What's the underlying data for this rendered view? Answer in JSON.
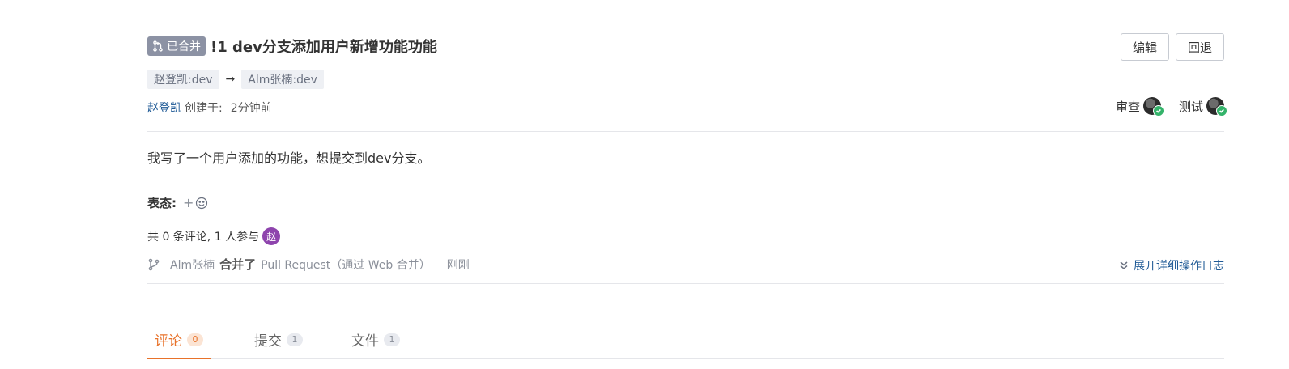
{
  "header": {
    "status_badge": "已合并",
    "title": "!1 dev分支添加用户新增功能功能",
    "actions": {
      "edit": "编辑",
      "revert": "回退"
    }
  },
  "branches": {
    "source": "赵登凯:dev",
    "arrow": "→",
    "target": "Alm张楠:dev"
  },
  "meta": {
    "author": "赵登凯",
    "created_label": "创建于:",
    "created_time": "2分钟前",
    "reviewers": [
      {
        "label": "审查"
      },
      {
        "label": "测试"
      }
    ]
  },
  "description": "我写了一个用户添加的功能，想提交到dev分支。",
  "reactions": {
    "label": "表态:",
    "add": "+"
  },
  "stats": {
    "text": "共 0 条评论, 1 人参与",
    "participant_initial": "赵"
  },
  "activity": {
    "actor": "Alm张楠",
    "verb": "合并了",
    "detail": "Pull Request（通过 Web 合并）",
    "time": "刚刚",
    "expand_label": "展开详细操作日志"
  },
  "tabs": [
    {
      "label": "评论",
      "count": "0",
      "active": true
    },
    {
      "label": "提交",
      "count": "1",
      "active": false
    },
    {
      "label": "文件",
      "count": "1",
      "active": false
    }
  ],
  "colors": {
    "accent": "#e8722a",
    "link": "#1f5a96",
    "merged_badge": "#8c92a4",
    "check": "#34b36a",
    "participant_avatar": "#8e44ad"
  }
}
